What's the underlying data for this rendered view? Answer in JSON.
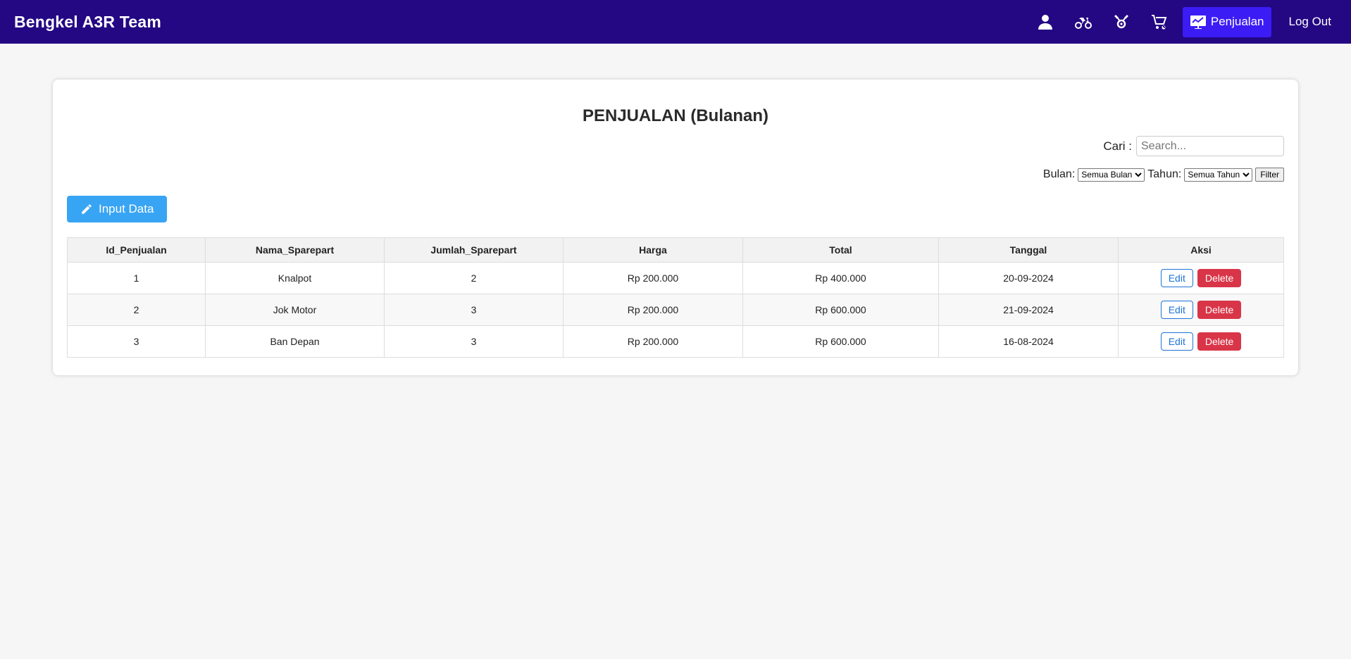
{
  "nav": {
    "brand": "Bengkel A3R Team",
    "icons": [
      "user-icon",
      "motorcycle-icon",
      "sparepart-icon",
      "cart-icon"
    ],
    "active_label": "Penjualan",
    "logout_label": "Log Out",
    "colors": {
      "bar": "#230783",
      "active": "#3b1cf4"
    }
  },
  "page": {
    "title": "PENJUALAN (Bulanan)",
    "search_label": "Cari :",
    "search_placeholder": "Search...",
    "bulan_label": "Bulan:",
    "bulan_selected": "Semua Bulan",
    "tahun_label": "Tahun:",
    "tahun_selected": "Semua Tahun",
    "filter_label": "Filter",
    "input_label": "Input Data"
  },
  "table": {
    "headers": [
      "Id_Penjualan",
      "Nama_Sparepart",
      "Jumlah_Sparepart",
      "Harga",
      "Total",
      "Tanggal",
      "Aksi"
    ],
    "rows": [
      {
        "id": "1",
        "nama": "Knalpot",
        "jumlah": "2",
        "harga": "Rp 200.000",
        "total": "Rp 400.000",
        "tanggal": "20-09-2024"
      },
      {
        "id": "2",
        "nama": "Jok Motor",
        "jumlah": "3",
        "harga": "Rp 200.000",
        "total": "Rp 600.000",
        "tanggal": "21-09-2024"
      },
      {
        "id": "3",
        "nama": "Ban Depan",
        "jumlah": "3",
        "harga": "Rp 200.000",
        "total": "Rp 600.000",
        "tanggal": "16-08-2024"
      }
    ],
    "edit_label": "Edit",
    "delete_label": "Delete"
  }
}
